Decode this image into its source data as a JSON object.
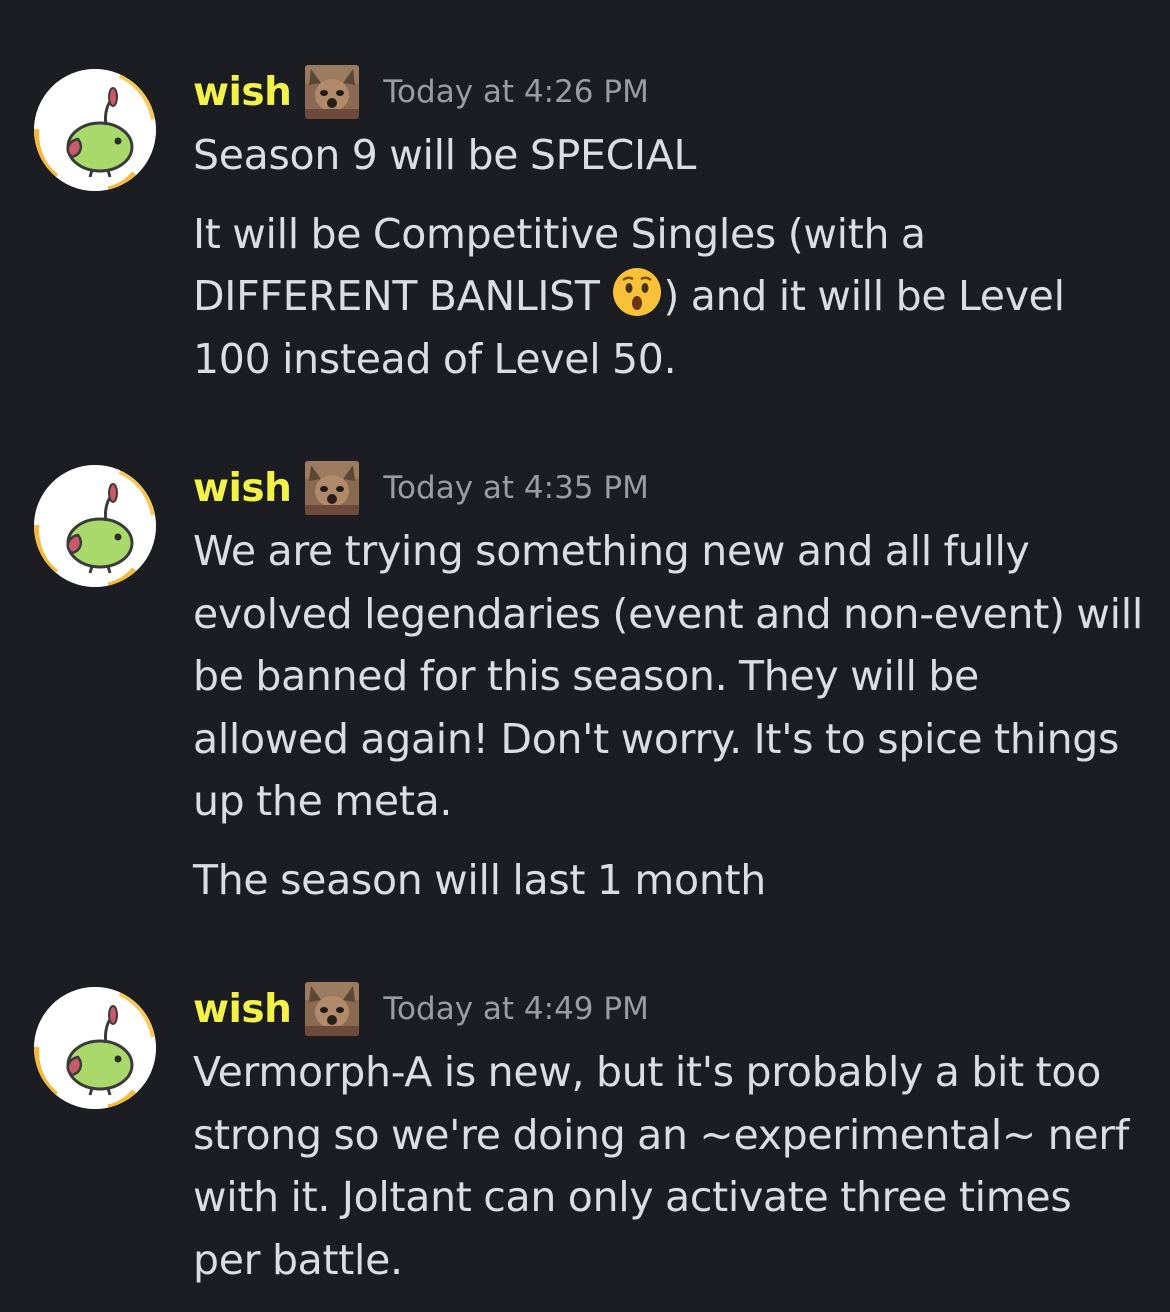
{
  "messages": [
    {
      "username": "wish",
      "avatar": "green-bird-avatar",
      "role_icon": "cat-face-role-icon",
      "timestamp": "Today at 4:26 PM",
      "p1": "Season 9 will be SPECIAL",
      "p2a": "It will be Competitive Singles (with a DIFFERENT BANLIST ",
      "emoji": "hushed-face-emoji",
      "p2b": ") and it will be Level 100 instead of Level 50."
    },
    {
      "username": "wish",
      "avatar": "green-bird-avatar",
      "role_icon": "cat-face-role-icon",
      "timestamp": "Today at 4:35 PM",
      "p1": "We are trying something new and all fully evolved legendaries (event and non-event) will be banned for this season. They will be allowed again! Don't worry. It's to spice things up the meta.",
      "p2": "The season will last 1 month"
    },
    {
      "username": "wish",
      "avatar": "green-bird-avatar",
      "role_icon": "cat-face-role-icon",
      "timestamp": "Today at 4:49 PM",
      "p1": "Vermorph-A is new, but it's probably a bit too strong so we're doing an ~experimental~ nerf with it. Joltant can only activate three times per battle."
    }
  ],
  "colors": {
    "background": "#1c1d22",
    "username": "#f2f24a",
    "timestamp": "#9a9ca3",
    "text": "#dcdde1"
  }
}
